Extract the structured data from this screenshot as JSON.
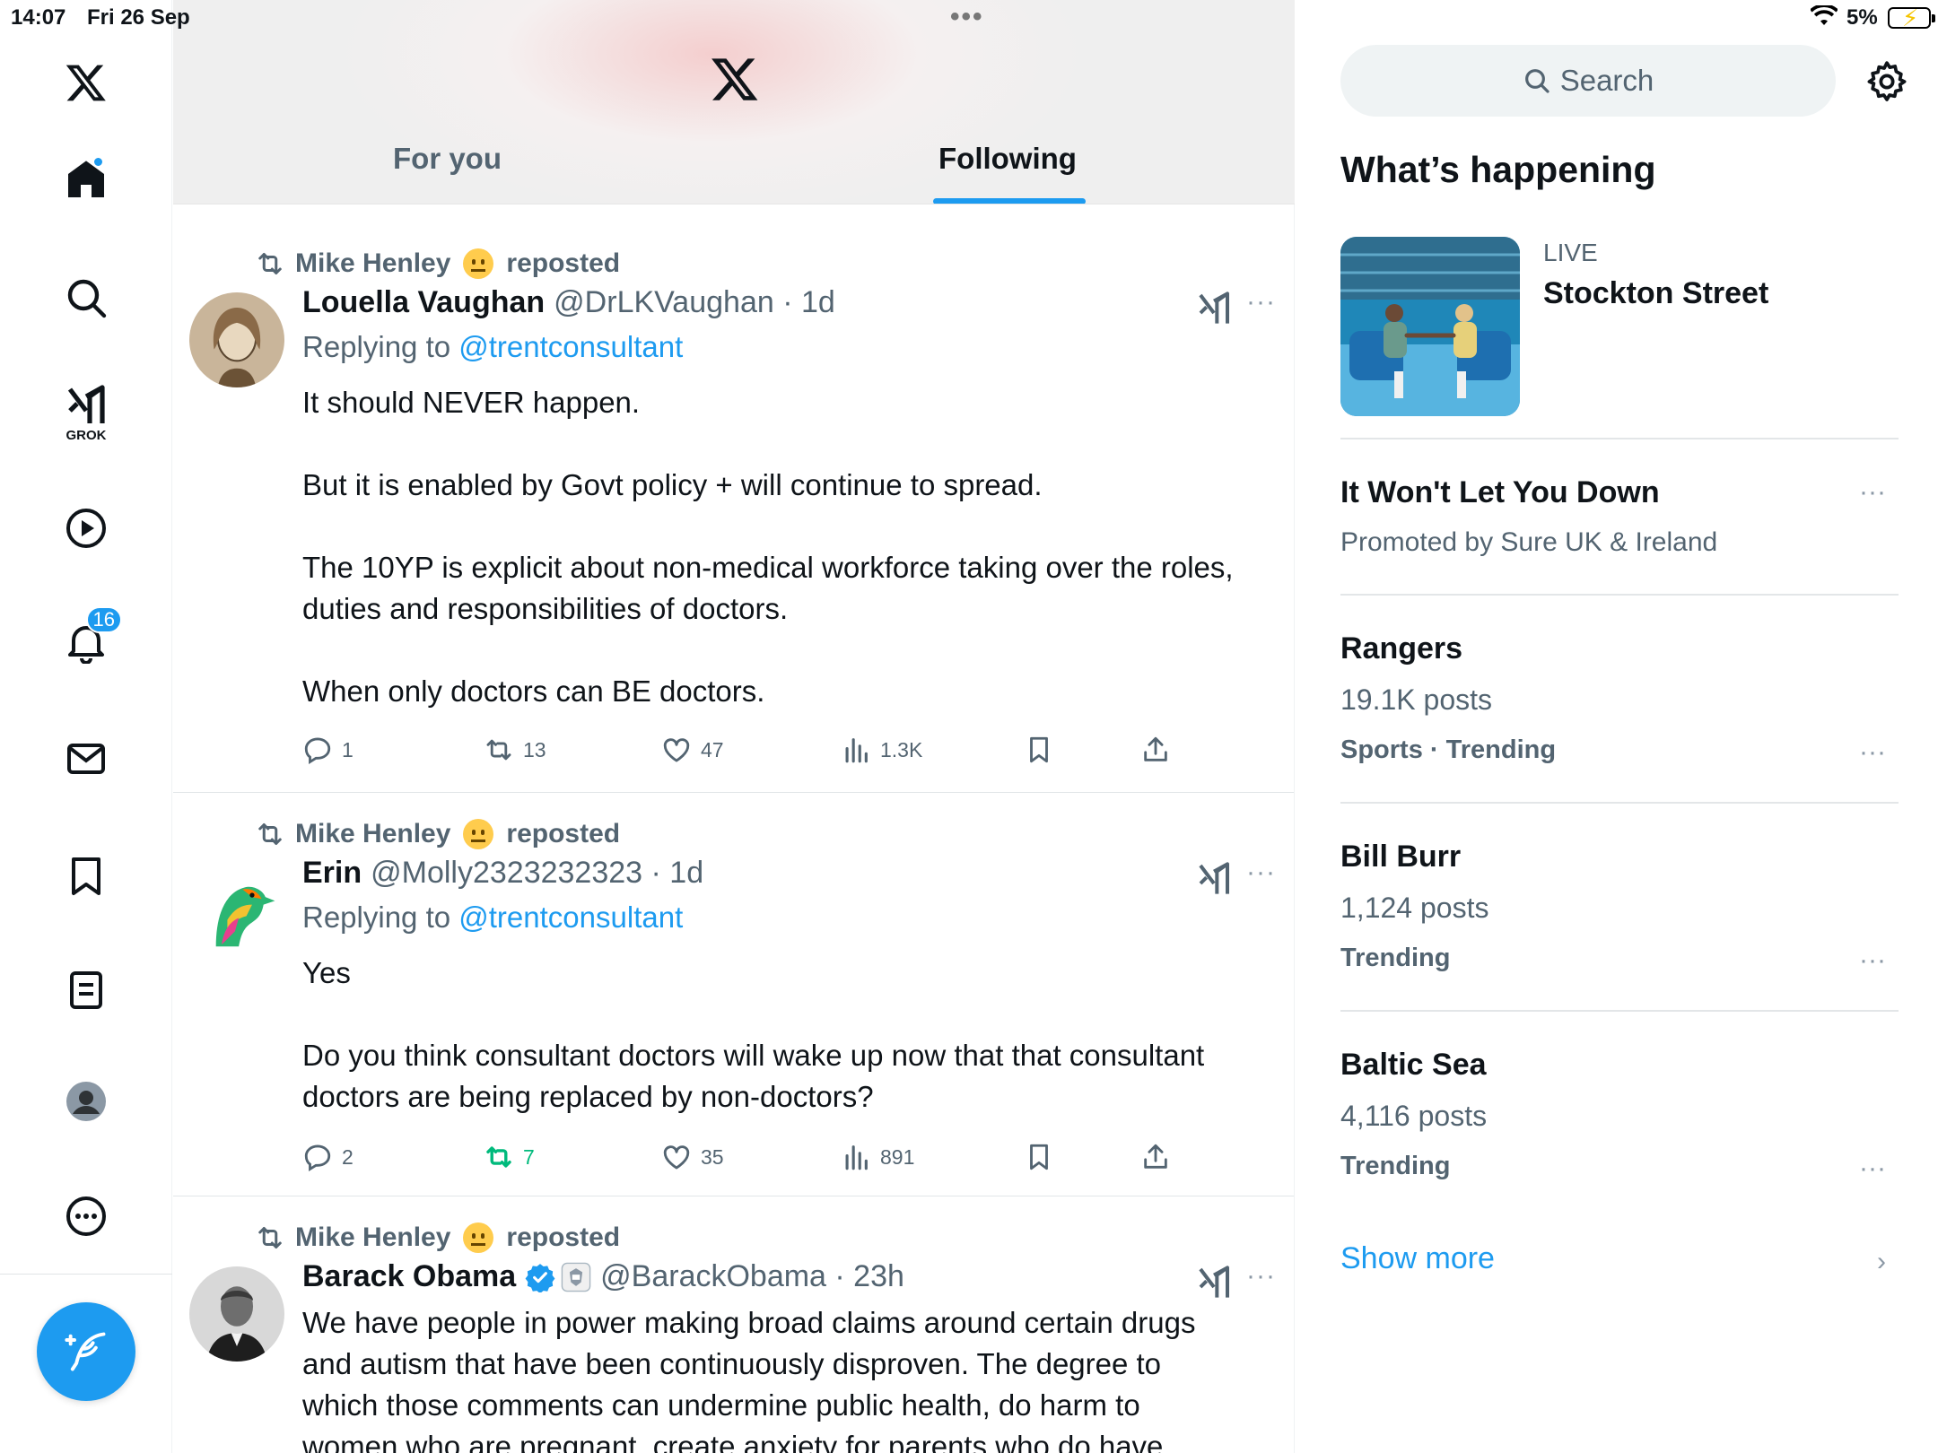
{
  "status_bar": {
    "time": "14:07",
    "date": "Fri 26 Sep",
    "battery": "5%"
  },
  "nav": {
    "notifications_badge": "16",
    "grok_label": "GROK"
  },
  "header": {
    "tabs": [
      {
        "label": "For you"
      },
      {
        "label": "Following"
      }
    ],
    "active_tab": "Following"
  },
  "posts": [
    {
      "reposted_by": "Mike Henley",
      "repost_suffix": "reposted",
      "name": "Louella Vaughan",
      "handle_time": "@DrLKVaughan · 1d",
      "replying_prefix": "Replying to ",
      "replying_handle": "@trentconsultant",
      "body": "It should NEVER happen.\n\nBut it is enabled by Govt policy + will continue to spread.\n\nThe 10YP is explicit about non-medical workforce taking over the roles,\nduties and responsibilities of doctors.\n\nWhen only doctors can BE doctors.",
      "replies": "1",
      "reposts": "13",
      "likes": "47",
      "views": "1.3K"
    },
    {
      "reposted_by": "Mike Henley",
      "repost_suffix": "reposted",
      "name": "Erin",
      "handle_time": "@Molly2323232323 · 1d",
      "replying_prefix": "Replying to ",
      "replying_handle": "@trentconsultant",
      "body": "Yes\n\nDo you think consultant doctors will wake up now that that consultant\ndoctors are being replaced by non-doctors?",
      "replies": "2",
      "reposts": "7",
      "likes": "35",
      "views": "891"
    },
    {
      "reposted_by": "Mike Henley",
      "repost_suffix": "reposted",
      "name": "Barack Obama",
      "handle_time": "@BarackObama · 23h",
      "body": "We have people in power making broad claims around certain drugs\nand autism that have been continuously disproven. The degree to\nwhich those comments can undermine public health, do harm to\nwomen who are pregnant, create anxiety for parents who do have"
    }
  ],
  "sidebar": {
    "search_placeholder": "Search",
    "heading": "What’s happening",
    "live": {
      "label": "LIVE",
      "title": "Stockton Street"
    },
    "promoted": {
      "title": "It Won't Let You Down",
      "sub": "Promoted by Sure UK & Ireland"
    },
    "trends": [
      {
        "title": "Rangers",
        "posts": "19.1K posts",
        "category": "Sports · Trending"
      },
      {
        "title": "Bill Burr",
        "posts": "1,124 posts",
        "category": "Trending"
      },
      {
        "title": "Baltic Sea",
        "posts": "4,116 posts",
        "category": "Trending"
      }
    ],
    "show_more": "Show more"
  },
  "colors": {
    "accent": "#1d9bf0",
    "repost_green": "#00ba7c",
    "secondary_text": "#536471"
  }
}
